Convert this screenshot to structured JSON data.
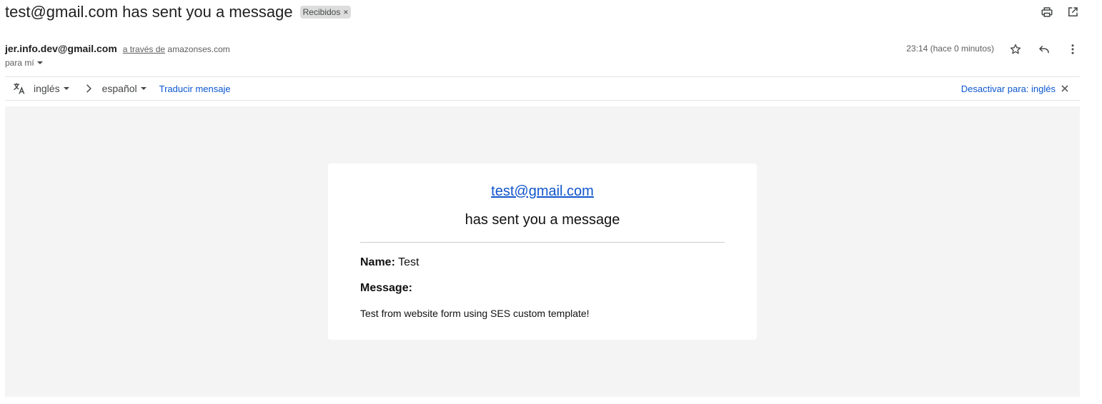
{
  "email": {
    "subject": "test@gmail.com has sent you a message",
    "label": {
      "text": "Recibidos",
      "remove_icon": "close-icon"
    },
    "sender": {
      "name": "jer.info.dev@gmail.com",
      "via_label": "a través de",
      "via_domain": "amazonses.com"
    },
    "to_label": "para mí",
    "time": "23:14 (hace 0 minutos)"
  },
  "toolbar": {
    "print_icon": "print-icon",
    "open_new_window_icon": "open-in-new-icon",
    "star_icon": "star-icon",
    "reply_icon": "reply-icon",
    "more_icon": "more-vertical-icon"
  },
  "translate": {
    "translate_icon": "translate-icon",
    "source_lang": "inglés",
    "target_lang": "español",
    "translate_link": "Traducir mensaje",
    "disable_link": "Desactivar para: inglés",
    "close_icon": "close-icon"
  },
  "body": {
    "email_link": "test@gmail.com",
    "subtitle": "has sent you a message",
    "name_label": "Name:",
    "name_value": "Test",
    "message_label": "Message:",
    "message_text": "Test from website form using SES custom template!"
  },
  "colors": {
    "link_blue": "#0b57d0",
    "email_link_blue": "#1155cc",
    "body_background": "#f4f4f4"
  }
}
